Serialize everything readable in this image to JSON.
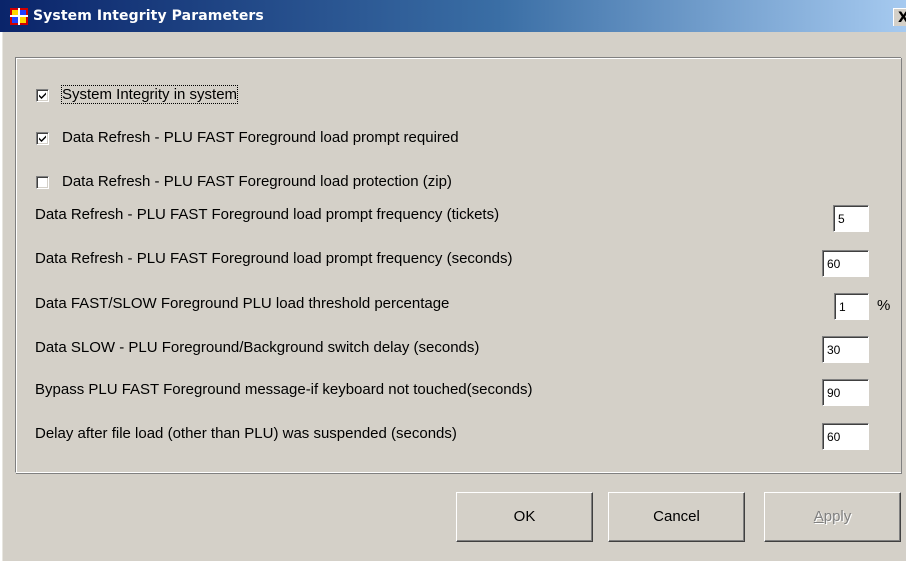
{
  "window": {
    "title": "System Integrity Parameters",
    "icon": "app-grid-icon",
    "close_label": "X"
  },
  "checkboxes": [
    {
      "label": "System Integrity in system",
      "checked": true,
      "focused": true
    },
    {
      "label": "Data Refresh - PLU FAST Foreground load prompt required",
      "checked": true,
      "focused": false
    },
    {
      "label": "Data Refresh - PLU FAST Foreground load protection (zip)",
      "checked": false,
      "focused": false
    }
  ],
  "parameters": [
    {
      "label": "Data Refresh - PLU FAST Foreground load prompt frequency (tickets)",
      "value": "5",
      "unit": ""
    },
    {
      "label": "Data Refresh - PLU FAST Foreground load prompt frequency (seconds)",
      "value": "60",
      "unit": ""
    },
    {
      "label": "Data FAST/SLOW Foreground PLU load threshold percentage",
      "value": "1",
      "unit": "%"
    },
    {
      "label": "Data SLOW - PLU Foreground/Background switch delay (seconds)",
      "value": "30",
      "unit": ""
    },
    {
      "label": "Bypass PLU FAST Foreground message-if keyboard not touched(seconds)",
      "value": "90",
      "unit": ""
    },
    {
      "label": "Delay after file load (other than PLU) was suspended (seconds)",
      "value": "60",
      "unit": ""
    }
  ],
  "buttons": {
    "ok": "OK",
    "cancel": "Cancel",
    "apply_mnemonic": "A",
    "apply_rest": "pply",
    "apply_enabled": false
  },
  "colors": {
    "title_bar_start": "#0a246a",
    "title_bar_end": "#a6caf0",
    "face": "#d4d0c8",
    "disabled_text": "#808080"
  }
}
